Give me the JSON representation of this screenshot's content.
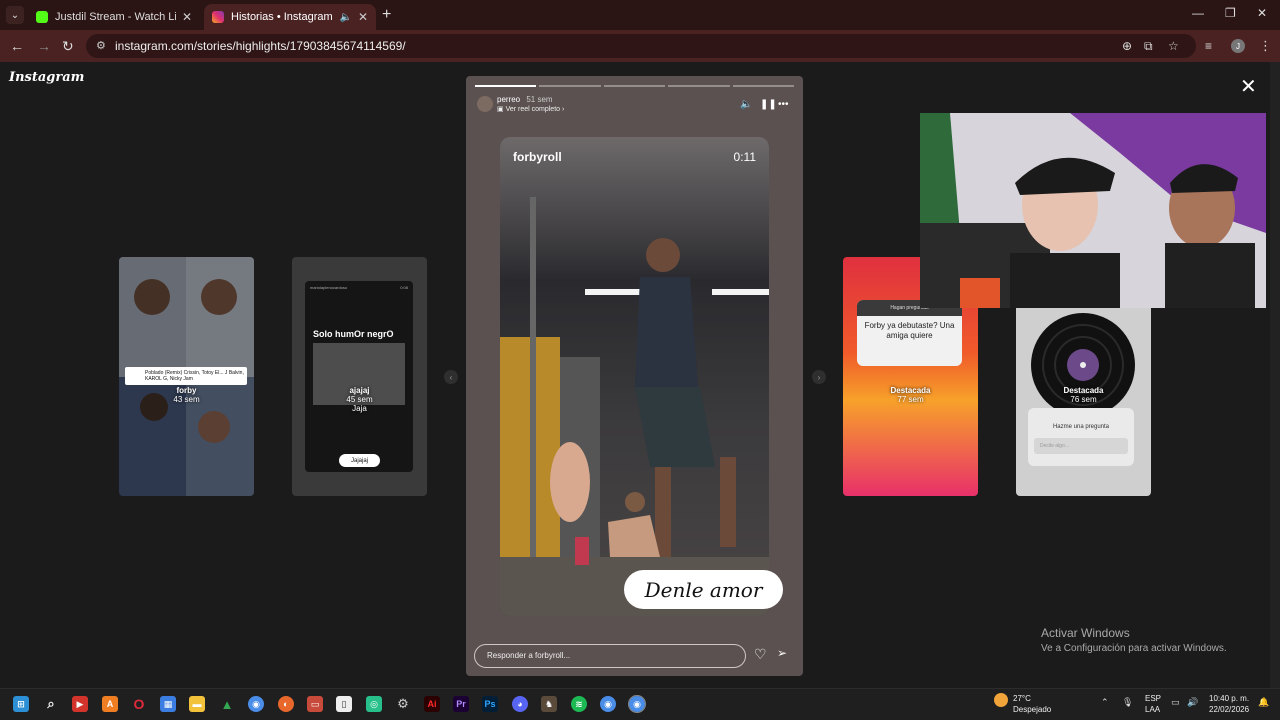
{
  "browser": {
    "tabs": [
      {
        "title": "Justdil Stream - Watch Live on Kick",
        "active": false,
        "favicon_color": "#53fc18"
      },
      {
        "title": "Historias • Instagram",
        "active": true,
        "favicon_color": "#e1306c"
      }
    ],
    "url": "instagram.com/stories/highlights/17903845674114569/",
    "profile_initial": "J"
  },
  "instagram": {
    "logo": "Instagram",
    "story": {
      "username": "perreo",
      "age": "51 sem",
      "reel_link": "Ver reel completo",
      "video_user": "forbyroll",
      "video_time": "0:11",
      "sticker_text": "Denle amor",
      "reply_placeholder": "Responder a forbyroll...",
      "progress_total": 5,
      "progress_current": 1
    },
    "side_cards": [
      {
        "name": "forby",
        "age": "43 sem",
        "extra": "Poblado (Remix) Crissin, Totoy El... J Balvin, KAROL G, Nicky Jam"
      },
      {
        "name": "ajajaj",
        "age": "45 sem",
        "extra": "Jaja",
        "header": "mariolaplenocardoso",
        "header_time": "0:08",
        "title": "Solo humOr negrO",
        "button": "Jajajaj"
      },
      {
        "name": "Destacada",
        "age": "77 sem",
        "question": "Forby ya debutaste? Una amiga quiere",
        "header": "Hagan preguntas"
      },
      {
        "name": "Destacada",
        "age": "76 sem",
        "question": "Hazme una pregunta",
        "input": "Decile algo..."
      }
    ]
  },
  "windows_watermark": {
    "title": "Activar Windows",
    "subtitle": "Ve a Configuración para activar Windows."
  },
  "taskbar": {
    "weather_temp": "27°C",
    "weather_desc": "Despejado",
    "lang_top": "ESP",
    "lang_bottom": "LAA",
    "time": "10:40 p. m.",
    "date": "22/02/2026"
  }
}
